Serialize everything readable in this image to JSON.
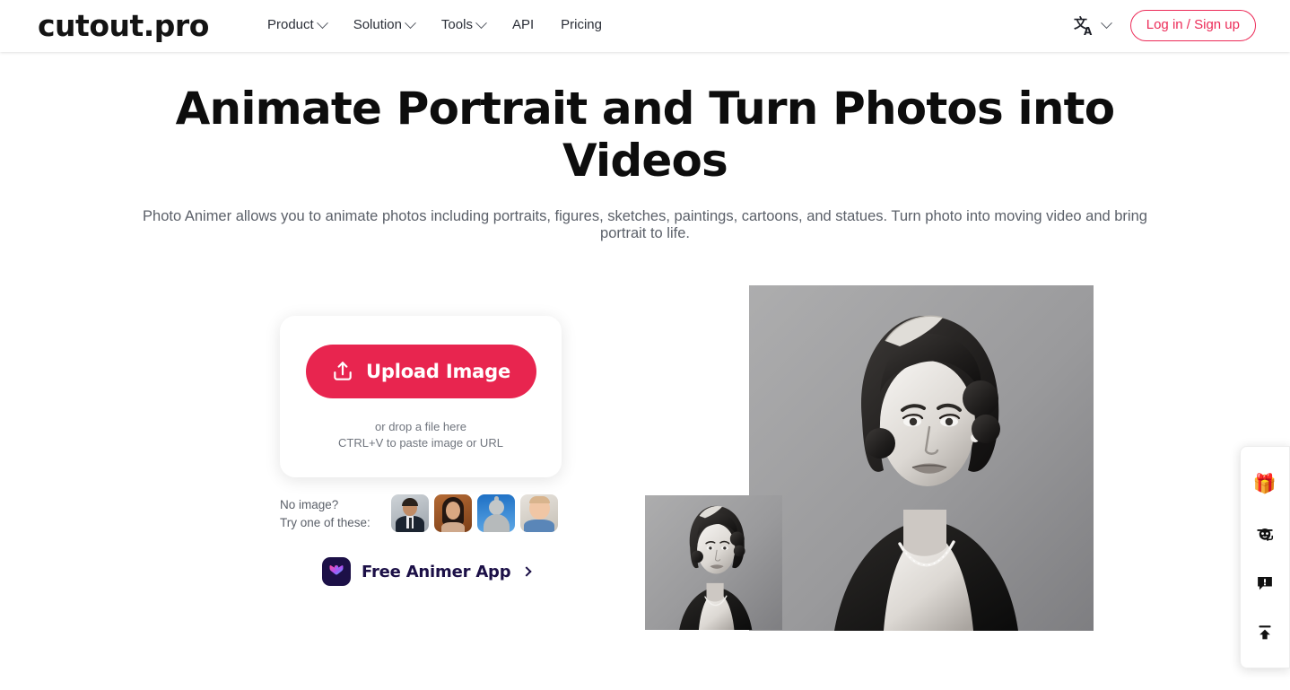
{
  "header": {
    "logo": "cutout.pro",
    "nav": [
      {
        "label": "Product",
        "has_chevron": true
      },
      {
        "label": "Solution",
        "has_chevron": true
      },
      {
        "label": "Tools",
        "has_chevron": true
      },
      {
        "label": "API",
        "has_chevron": false
      },
      {
        "label": "Pricing",
        "has_chevron": false
      }
    ],
    "language_icon": "translate-icon",
    "login_label": "Log in / Sign up",
    "accent_color": "#ec2b58"
  },
  "hero": {
    "title": "Animate Portrait and Turn Photos into Videos",
    "subtitle": "Photo Animer allows you to animate photos including portraits, figures, sketches, paintings, cartoons, and statues. Turn photo into moving video and bring portrait to life."
  },
  "upload": {
    "button_label": "Upload Image",
    "button_icon": "upload-icon",
    "button_color": "#e8254f",
    "drop_hint_line1": "or drop a file here",
    "drop_hint_line2": "CTRL+V to paste image or URL"
  },
  "samples": {
    "label_line1": "No image?",
    "label_line2": "Try one of these:",
    "thumbnails": [
      {
        "name": "sample-man-in-suit",
        "alt": "Man in suit"
      },
      {
        "name": "sample-woman-portrait",
        "alt": "Woman portrait"
      },
      {
        "name": "sample-buddha-statue",
        "alt": "Buddha statue"
      },
      {
        "name": "sample-baby",
        "alt": "Baby"
      }
    ]
  },
  "animer_app": {
    "label": "Free Animer App",
    "icon": "animer-app-icon",
    "arrow": "chevron-right-icon"
  },
  "preview": {
    "big_image_alt": "Black and white vintage portrait of a woman, enlarged result",
    "small_image_alt": "Black and white vintage portrait of a woman, source thumbnail"
  },
  "float_sidebar": {
    "items": [
      {
        "name": "gift-icon",
        "glyph": "🎁",
        "title": "Gifts"
      },
      {
        "name": "customer-service-icon",
        "title": "Customer service"
      },
      {
        "name": "feedback-icon",
        "title": "Feedback"
      },
      {
        "name": "back-to-top-icon",
        "title": "Back to top"
      }
    ]
  }
}
